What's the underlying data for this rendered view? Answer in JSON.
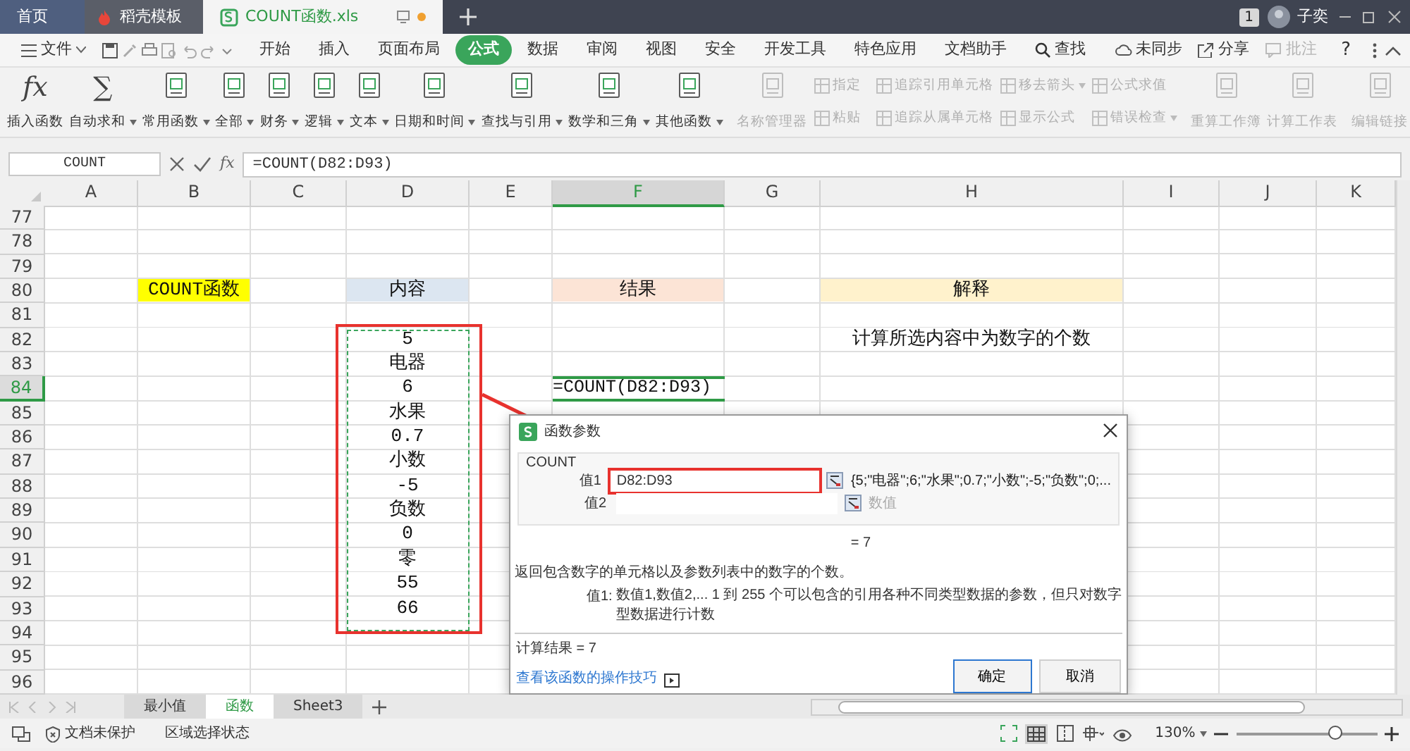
{
  "app_tabs": [
    {
      "label": "首页",
      "selected": false,
      "kind": "home"
    },
    {
      "label": "稻壳模板",
      "selected": false,
      "kind": "template"
    },
    {
      "label": "COUNT函数.xls",
      "selected": true,
      "kind": "document"
    }
  ],
  "account": {
    "badge": "1",
    "user": "子奕"
  },
  "menu": {
    "file": "文件",
    "tabs": [
      {
        "label": "开始",
        "selected": false
      },
      {
        "label": "插入",
        "selected": false
      },
      {
        "label": "页面布局",
        "selected": false
      },
      {
        "label": "公式",
        "selected": true
      },
      {
        "label": "数据",
        "selected": false
      },
      {
        "label": "审阅",
        "selected": false
      },
      {
        "label": "视图",
        "selected": false
      },
      {
        "label": "安全",
        "selected": false
      },
      {
        "label": "开发工具",
        "selected": false
      },
      {
        "label": "特色应用",
        "selected": false
      },
      {
        "label": "文档助手",
        "selected": false
      }
    ],
    "search": "查找",
    "right": [
      {
        "label": "未同步",
        "disabled": false
      },
      {
        "label": "分享",
        "disabled": false
      },
      {
        "label": "批注",
        "disabled": true
      }
    ],
    "help": "?"
  },
  "ribbon": [
    {
      "kind": "large",
      "label": "插入函数",
      "glyph": "fx",
      "dropdown": false,
      "disabled": false
    },
    {
      "kind": "large",
      "label": "自动求和",
      "glyph": "∑",
      "dropdown": true,
      "disabled": false
    },
    {
      "kind": "large",
      "label": "常用函数",
      "dropdown": true,
      "disabled": false
    },
    {
      "kind": "large",
      "label": "全部",
      "dropdown": true,
      "disabled": false
    },
    {
      "kind": "large",
      "label": "财务",
      "dropdown": true,
      "disabled": false
    },
    {
      "kind": "large",
      "label": "逻辑",
      "dropdown": true,
      "disabled": false
    },
    {
      "kind": "large",
      "label": "文本",
      "dropdown": true,
      "disabled": false
    },
    {
      "kind": "large",
      "label": "日期和时间",
      "dropdown": true,
      "disabled": false
    },
    {
      "kind": "large",
      "label": "查找与引用",
      "dropdown": true,
      "disabled": false
    },
    {
      "kind": "large",
      "label": "数学和三角",
      "dropdown": true,
      "disabled": false
    },
    {
      "kind": "large",
      "label": "其他函数",
      "dropdown": true,
      "disabled": false
    },
    {
      "kind": "separator"
    },
    {
      "kind": "large",
      "label": "名称管理器",
      "dropdown": false,
      "disabled": true
    },
    {
      "kind": "stack",
      "items": [
        {
          "label": "指定",
          "dropdown": false,
          "disabled": true
        },
        {
          "label": "粘贴",
          "dropdown": false,
          "disabled": true
        }
      ]
    },
    {
      "kind": "separator"
    },
    {
      "kind": "stack",
      "items": [
        {
          "label": "追踪引用单元格",
          "dropdown": false,
          "disabled": true
        },
        {
          "label": "追踪从属单元格",
          "dropdown": false,
          "disabled": true
        }
      ]
    },
    {
      "kind": "stack",
      "items": [
        {
          "label": "移去箭头",
          "dropdown": true,
          "disabled": true
        },
        {
          "label": "显示公式",
          "dropdown": false,
          "disabled": true
        }
      ]
    },
    {
      "kind": "stack",
      "items": [
        {
          "label": "公式求值",
          "dropdown": false,
          "disabled": true
        },
        {
          "label": "错误检查",
          "dropdown": true,
          "disabled": true
        }
      ]
    },
    {
      "kind": "separator"
    },
    {
      "kind": "large",
      "label": "重算工作簿",
      "dropdown": false,
      "disabled": true
    },
    {
      "kind": "large",
      "label": "计算工作表",
      "dropdown": false,
      "disabled": true
    },
    {
      "kind": "separator"
    },
    {
      "kind": "large",
      "label": "编辑链接",
      "dropdown": false,
      "disabled": true
    }
  ],
  "formula_bar": {
    "name_box": "COUNT",
    "fx": "fx",
    "formula": "=COUNT(D82:D93)"
  },
  "columns": [
    {
      "label": "A",
      "selected": false
    },
    {
      "label": "B",
      "selected": false
    },
    {
      "label": "C",
      "selected": false
    },
    {
      "label": "D",
      "selected": false
    },
    {
      "label": "E",
      "selected": false
    },
    {
      "label": "F",
      "selected": true
    },
    {
      "label": "G",
      "selected": false
    },
    {
      "label": "H",
      "selected": false
    },
    {
      "label": "I",
      "selected": false
    },
    {
      "label": "J",
      "selected": false
    },
    {
      "label": "K",
      "selected": false
    }
  ],
  "rows": [
    {
      "number": "77",
      "selected": false
    },
    {
      "number": "78",
      "selected": false
    },
    {
      "number": "79",
      "selected": false
    },
    {
      "number": "80",
      "selected": false,
      "cells": [
        null,
        {
          "text": "COUNT函数",
          "color": "#ffff00"
        },
        null,
        {
          "text": "内容",
          "color": "#dce6f1"
        },
        null,
        {
          "text": "结果",
          "color": "#fce4d6"
        },
        null,
        {
          "text": "解释",
          "color": "#fff2cc"
        },
        null,
        null,
        null
      ]
    },
    {
      "number": "81",
      "selected": false
    },
    {
      "number": "82",
      "selected": false,
      "cells": [
        null,
        null,
        null,
        {
          "text": "5"
        },
        null,
        null,
        null,
        {
          "text": "计算所选内容中为数字的个数"
        },
        null,
        null,
        null
      ]
    },
    {
      "number": "83",
      "selected": false,
      "cells": [
        null,
        null,
        null,
        {
          "text": "电器"
        },
        null,
        null,
        null,
        null,
        null,
        null,
        null
      ]
    },
    {
      "number": "84",
      "selected": true,
      "cells": [
        null,
        null,
        null,
        {
          "text": "6"
        },
        null,
        {
          "text": "=COUNT(D82:D93)",
          "active": true
        },
        null,
        null,
        null,
        null,
        null
      ]
    },
    {
      "number": "85",
      "selected": false,
      "cells": [
        null,
        null,
        null,
        {
          "text": "水果"
        },
        null,
        null,
        null,
        null,
        null,
        null,
        null
      ]
    },
    {
      "number": "86",
      "selected": false,
      "cells": [
        null,
        null,
        null,
        {
          "text": "0.7"
        },
        null,
        null,
        null,
        null,
        null,
        null,
        null
      ]
    },
    {
      "number": "87",
      "selected": false,
      "cells": [
        null,
        null,
        null,
        {
          "text": "小数"
        },
        null,
        null,
        null,
        null,
        null,
        null,
        null
      ]
    },
    {
      "number": "88",
      "selected": false,
      "cells": [
        null,
        null,
        null,
        {
          "text": "-5"
        },
        null,
        null,
        null,
        null,
        null,
        null,
        null
      ]
    },
    {
      "number": "89",
      "selected": false,
      "cells": [
        null,
        null,
        null,
        {
          "text": "负数"
        },
        null,
        null,
        null,
        null,
        null,
        null,
        null
      ]
    },
    {
      "number": "90",
      "selected": false,
      "cells": [
        null,
        null,
        null,
        {
          "text": "0"
        },
        null,
        null,
        null,
        null,
        null,
        null,
        null
      ]
    },
    {
      "number": "91",
      "selected": false,
      "cells": [
        null,
        null,
        null,
        {
          "text": "零"
        },
        null,
        null,
        null,
        null,
        null,
        null,
        null
      ]
    },
    {
      "number": "92",
      "selected": false,
      "cells": [
        null,
        null,
        null,
        {
          "text": "55"
        },
        null,
        null,
        null,
        null,
        null,
        null,
        null
      ]
    },
    {
      "number": "93",
      "selected": false,
      "cells": [
        null,
        null,
        null,
        {
          "text": "66"
        },
        null,
        null,
        null,
        null,
        null,
        null,
        null
      ]
    },
    {
      "number": "94",
      "selected": false
    },
    {
      "number": "95",
      "selected": false
    },
    {
      "number": "96",
      "selected": false
    }
  ],
  "dialog": {
    "title": "函数参数",
    "function": "COUNT",
    "args": [
      {
        "label": "值1",
        "value": "D82:D93",
        "result": "{5;\"电器\";6;\"水果\";0.7;\"小数\";-5;\"负数\";0;...",
        "highlighted": true
      },
      {
        "label": "值2",
        "hint": "数值",
        "highlighted": false
      }
    ],
    "result": "= 7",
    "description": "返回包含数字的单元格以及参数列表中的数字的个数。",
    "param_label": "值1:",
    "param_text": "数值1,数值2,... 1 到 255 个可以包含的引用各种不同类型数据的参数，但只对数字型数据进行计数",
    "calc_result": "计算结果 = 7",
    "link": "查看该函数的操作技巧",
    "buttons": [
      {
        "label": "确定",
        "kind": "primary"
      },
      {
        "label": "取消",
        "kind": "secondary"
      }
    ]
  },
  "sheet_tabs": [
    {
      "label": "最小值",
      "selected": false
    },
    {
      "label": "函数",
      "selected": true
    },
    {
      "label": "Sheet3",
      "selected": false
    }
  ],
  "status_bar": {
    "protection": "文档未保护",
    "selection": "区域选择状态",
    "zoom": "130%",
    "level": 0.7
  }
}
